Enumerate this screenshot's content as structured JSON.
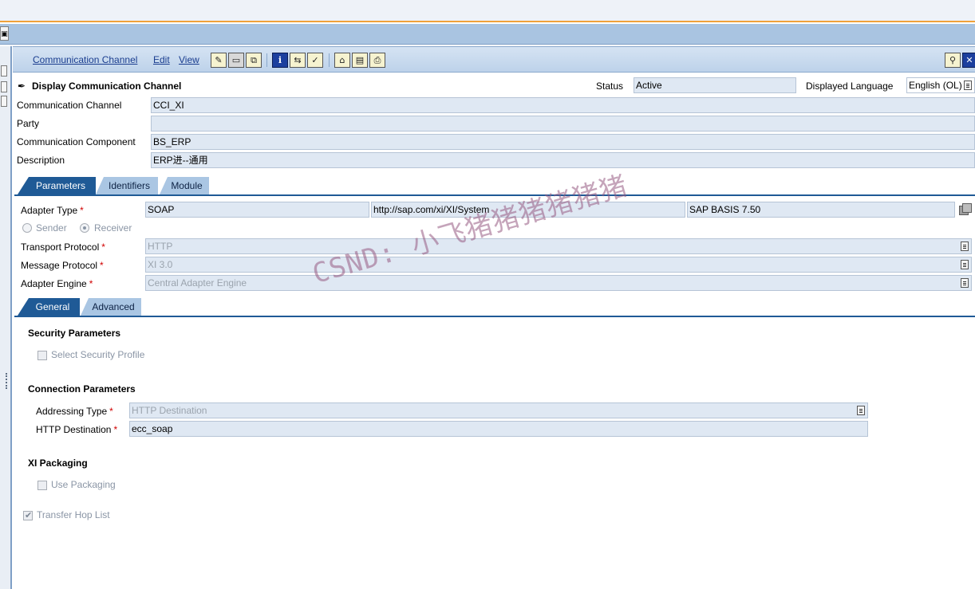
{
  "menu": {
    "communication_channel": "Communication Channel",
    "edit": "Edit",
    "view": "View"
  },
  "header": {
    "title": "Display Communication Channel",
    "status_label": "Status",
    "status_value": "Active",
    "language_label": "Displayed Language",
    "language_value": "English (OL)"
  },
  "form": {
    "channel_label": "Communication Channel",
    "channel_value": "CCI_XI",
    "party_label": "Party",
    "party_value": "",
    "component_label": "Communication Component",
    "component_value": "BS_ERP",
    "description_label": "Description",
    "description_value": "ERP进--通用"
  },
  "tabs": {
    "parameters": "Parameters",
    "identifiers": "Identifiers",
    "module": "Module"
  },
  "params": {
    "adapter_type_label": "Adapter Type",
    "adapter_type": "SOAP",
    "adapter_namespace": "http://sap.com/xi/XI/System",
    "adapter_swcv": "SAP BASIS 7.50",
    "sender_label": "Sender",
    "receiver_label": "Receiver",
    "direction_selected": "Receiver",
    "transport_protocol_label": "Transport Protocol",
    "transport_protocol": "HTTP",
    "message_protocol_label": "Message Protocol",
    "message_protocol": "XI 3.0",
    "adapter_engine_label": "Adapter Engine",
    "adapter_engine": "Central Adapter Engine",
    "required_mark": "*"
  },
  "subtabs": {
    "general": "General",
    "advanced": "Advanced"
  },
  "general": {
    "security_title": "Security Parameters",
    "select_security_profile": "Select Security Profile",
    "select_security_profile_checked": false,
    "connection_title": "Connection Parameters",
    "addressing_type_label": "Addressing Type",
    "addressing_type": "HTTP Destination",
    "http_destination_label": "HTTP Destination",
    "http_destination": "ecc_soap",
    "packaging_title": "XI Packaging",
    "use_packaging": "Use Packaging",
    "use_packaging_checked": false,
    "transfer_hop_list": "Transfer Hop List",
    "transfer_hop_list_checked": true
  },
  "watermark": "CSND: 小飞猪猪猪猪猪猪",
  "icons": {
    "toolbar": [
      "edit-pencil-icon",
      "save-icon",
      "copy-icon",
      "info-icon",
      "where-used-icon",
      "check-icon",
      "history-icon",
      "table-icon",
      "print-icon"
    ],
    "window": [
      "customize-icon",
      "close-icon"
    ]
  },
  "colors": {
    "menubar": "#bdd2ea",
    "tab_active": "#1f5a96",
    "tab_inactive": "#aac6e3",
    "field_bg": "#dfe8f3",
    "required": "#d00000",
    "accent_strip": "#f0a23a"
  }
}
